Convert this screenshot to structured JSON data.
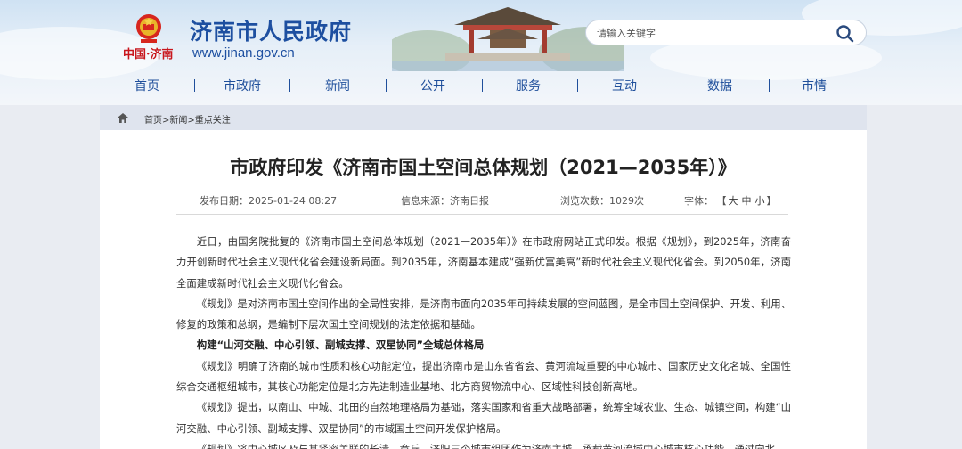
{
  "site": {
    "emblem_caption": "中国·济南",
    "name": "济南市人民政府",
    "url": "www.jinan.gov.cn"
  },
  "search": {
    "placeholder": "请输入关键字",
    "icon": "search-icon"
  },
  "nav": [
    "首页",
    "市政府",
    "新闻",
    "公开",
    "服务",
    "互动",
    "数据",
    "市情"
  ],
  "breadcrumb": {
    "home": "首页",
    "sep1": ">",
    "news": "新闻",
    "sep2": ">",
    "current": "重点关注"
  },
  "article": {
    "title": "市政府印发《济南市国土空间总体规划（2021—2035年）》",
    "meta": {
      "date_label": "发布日期：",
      "date": "2025-01-24 08:27",
      "source_label": "信息来源：",
      "source": "济南日报",
      "views_label": "浏览次数：",
      "views": "1029次",
      "font_label": "字体：",
      "font_open": "【",
      "font_large": "大",
      "font_medium": "中",
      "font_small": "小",
      "font_close": "】"
    },
    "paragraphs": [
      "近日，由国务院批复的《济南市国土空间总体规划（2021—2035年）》在市政府网站正式印发。根据《规划》，到2025年，济南奋力开创新时代社会主义现代化省会建设新局面。到2035年，济南基本建成“强新优富美高”新时代社会主义现代化省会。到2050年，济南全面建成新时代社会主义现代化省会。",
      "《规划》是对济南市国土空间作出的全局性安排，是济南市面向2035年可持续发展的空间蓝图，是全市国土空间保护、开发、利用、修复的政策和总纲，是编制下层次国土空间规划的法定依据和基础。",
      "构建“山河交融、中心引领、副城支撑、双星协同”全域总体格局",
      "《规划》明确了济南的城市性质和核心功能定位，提出济南市是山东省省会、黄河流域重要的中心城市、国家历史文化名城、全国性综合交通枢纽城市，其核心功能定位是北方先进制造业基地、北方商贸物流中心、区域性科技创新高地。",
      "《规划》提出，以南山、中城、北田的自然地理格局为基础，落实国家和省重大战略部署，统筹全域农业、生态、城镇空间，构建“山河交融、中心引领、副城支撑、双星协同”的市域国土空间开发保护格局。",
      "《规划》将中心城区及与其紧密关联的长清、章丘、济阳三个城市组团作为济南主城，承载黄河流域中心城市核心功能，通过向北、"
    ]
  }
}
